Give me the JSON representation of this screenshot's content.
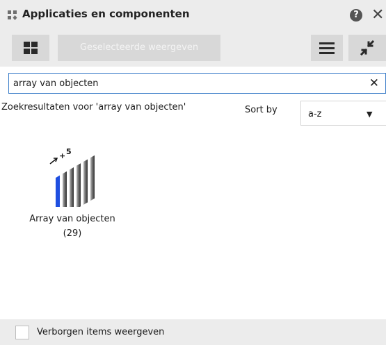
{
  "window": {
    "title": "Applicaties en componenten",
    "title_icon": "components-icon",
    "help_icon": "?",
    "close_icon": "✕"
  },
  "toolbar": {
    "tiles_icon": "grid-icon",
    "show_selected_label": "Geselecteerde weergeven",
    "menu_icon": "hamburger-icon",
    "collapse_icon": "collapse-arrows-icon"
  },
  "search": {
    "value": "array van objecten",
    "clear_icon": "✕"
  },
  "results": {
    "heading": "Zoekresultaten voor 'array van objecten'",
    "sort_label": "Sort by",
    "sort_value": "a-z",
    "sort_arrow": "▼",
    "items": [
      {
        "label": "Array van objecten",
        "count": "(29)",
        "icon": "array-of-objects-icon"
      }
    ]
  },
  "footer": {
    "show_hidden_label": "Verborgen items weergeven",
    "show_hidden_checked": false
  }
}
